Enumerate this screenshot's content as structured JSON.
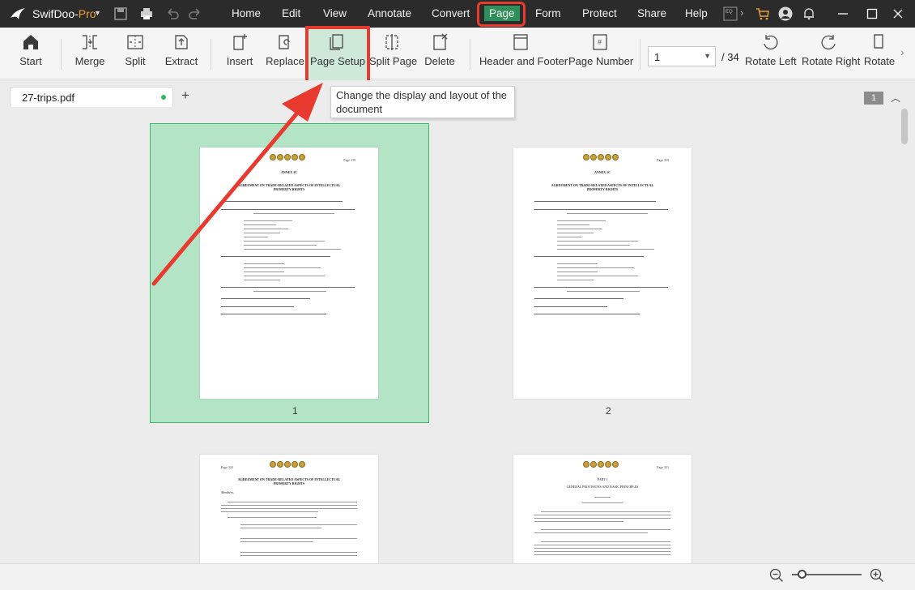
{
  "app": {
    "name_main": "SwifDoo-",
    "name_suffix": "Pro",
    "accent": "#2e8f5b",
    "highlight_color": "#e83a2e"
  },
  "menu": {
    "items": [
      {
        "label": "Home"
      },
      {
        "label": "Edit"
      },
      {
        "label": "View"
      },
      {
        "label": "Annotate"
      },
      {
        "label": "Convert"
      },
      {
        "label": "Page",
        "active": true
      },
      {
        "label": "Form"
      },
      {
        "label": "Protect"
      },
      {
        "label": "Share"
      },
      {
        "label": "Help"
      }
    ],
    "icons": [
      "save-icon",
      "print-icon",
      "undo-icon",
      "redo-icon",
      "qr-icon",
      "more-icon",
      "cart-icon",
      "user-icon",
      "bell-icon"
    ]
  },
  "ribbon": {
    "buttons": [
      {
        "label": "Start",
        "icon": "home-icon"
      },
      {
        "label": "Merge",
        "icon": "merge-icon"
      },
      {
        "label": "Split",
        "icon": "split-icon"
      },
      {
        "label": "Extract",
        "icon": "extract-icon"
      },
      {
        "label": "Insert",
        "icon": "insert-page-icon"
      },
      {
        "label": "Replace",
        "icon": "replace-page-icon"
      },
      {
        "label": "Page Setup",
        "icon": "page-setup-icon"
      },
      {
        "label": "Split Page",
        "icon": "split-page-icon"
      },
      {
        "label": "Delete",
        "icon": "delete-page-icon"
      },
      {
        "label": "Header and Footer",
        "icon": "header-footer-icon"
      },
      {
        "label": "Page Number",
        "icon": "page-number-icon"
      },
      {
        "label": "Rotate Left",
        "icon": "rotate-left-icon"
      },
      {
        "label": "Rotate Right",
        "icon": "rotate-right-icon"
      },
      {
        "label": "Rotate",
        "icon": "rotate-icon"
      }
    ],
    "page_select_value": "1",
    "page_total": "/ 34",
    "page_number_glyph": "#"
  },
  "tabs": {
    "file_name": "27-trips.pdf",
    "add_label": "+",
    "page_badge": "1"
  },
  "tooltip": {
    "text": "Change the display and layout of the document"
  },
  "thumbnails": [
    {
      "page_label": "1",
      "header": "Page 319",
      "title": "ANNEX 1C",
      "subtitle": "AGREEMENT ON TRADE-RELATED ASPECTS OF INTELLECTUAL PROPERTY RIGHTS",
      "selected": true
    },
    {
      "page_label": "2",
      "header": "Page 319",
      "title": "ANNEX 1C",
      "subtitle": "AGREEMENT ON TRADE-RELATED ASPECTS OF INTELLECTUAL PROPERTY RIGHTS",
      "selected": false
    },
    {
      "page_label": "",
      "header": "Page 320",
      "title": "AGREEMENT ON TRADE-RELATED ASPECTS OF INTELLECTUAL PROPERTY RIGHTS",
      "subtitle": "Members,"
    },
    {
      "page_label": "",
      "header": "Page 321",
      "title": "PART I",
      "subtitle": "GENERAL PROVISIONS AND BASIC PRINCIPLES"
    }
  ]
}
